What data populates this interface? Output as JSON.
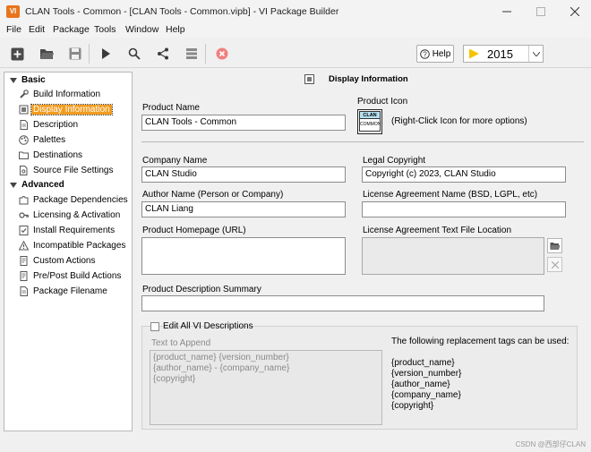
{
  "window": {
    "title": "CLAN Tools - Common - [CLAN Tools - Common.vipb] - VI Package Builder",
    "app_icon_text": "VI"
  },
  "menu": [
    "File",
    "Edit",
    "Package",
    "Tools",
    "Window",
    "Help"
  ],
  "toolbar": {
    "icons": [
      "new-icon",
      "open-folder-icon",
      "save-icon",
      "build-play-icon",
      "search-icon",
      "share-icon",
      "list-icon",
      "cancel-icon"
    ],
    "help_label": "Help",
    "version_value": "2015"
  },
  "nav": {
    "basic_label": "Basic",
    "basic_items": [
      {
        "label": "Build Information",
        "icon": "wrench-icon"
      },
      {
        "label": "Display Information",
        "icon": "display-icon"
      },
      {
        "label": "Description",
        "icon": "document-icon"
      },
      {
        "label": "Palettes",
        "icon": "palette-icon"
      },
      {
        "label": "Destinations",
        "icon": "folder-icon"
      },
      {
        "label": "Source File Settings",
        "icon": "settings-file-icon"
      }
    ],
    "advanced_label": "Advanced",
    "advanced_items": [
      {
        "label": "Package Dependencies",
        "icon": "puzzle-icon"
      },
      {
        "label": "Licensing & Activation",
        "icon": "key-icon"
      },
      {
        "label": "Install Requirements",
        "icon": "checklist-icon"
      },
      {
        "label": "Incompatible Packages",
        "icon": "warning-icon"
      },
      {
        "label": "Custom Actions",
        "icon": "script-icon"
      },
      {
        "label": "Pre/Post Build Actions",
        "icon": "script-icon"
      },
      {
        "label": "Package Filename",
        "icon": "document-icon"
      }
    ],
    "selected": "Display Information"
  },
  "panel": {
    "header": "Display Information",
    "product_name_label": "Product Name",
    "product_name_value": "CLAN Tools - Common",
    "product_icon_label": "Product Icon",
    "product_icon_text_top": "CLAN",
    "product_icon_text_bottom": "COMMON",
    "product_icon_hint": "(Right-Click Icon for more options)",
    "company_name_label": "Company Name",
    "company_name_value": "CLAN Studio",
    "legal_copyright_label": "Legal Copyright",
    "legal_copyright_value": "Copyright (c) 2023, CLAN Studio",
    "author_name_label": "Author Name (Person or Company)",
    "author_name_value": "CLAN Liang",
    "license_name_label": "License Agreement Name (BSD, LGPL, etc)",
    "license_name_value": "",
    "homepage_label": "Product Homepage (URL)",
    "homepage_value": "",
    "license_file_label": "License Agreement Text File Location",
    "license_file_value": "",
    "summary_label": "Product Description Summary",
    "summary_value": "",
    "edit_all_label": "Edit All VI Descriptions",
    "edit_all_checked": false,
    "text_to_append_label": "Text to Append",
    "text_to_append_lines": [
      "{product_name} {version_number}",
      "{author_name} - {company_name}",
      "{copyright}"
    ],
    "replacement_title": "The following replacement tags can be used:",
    "replacement_tags": [
      "{product_name}",
      "{version_number}",
      "{author_name}",
      "{company_name}",
      "{copyright}"
    ]
  },
  "watermark": "CSDN @西部仔CLAN"
}
